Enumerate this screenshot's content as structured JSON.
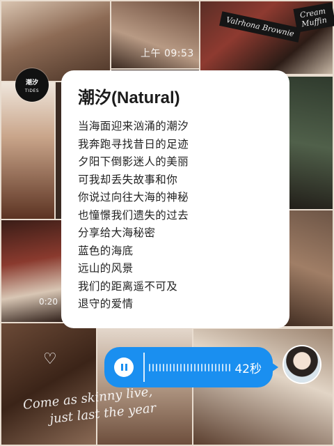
{
  "status": {
    "time": "上午 09:53"
  },
  "background": {
    "signs": [
      "Valrhona Brownie",
      "Cream Muffin"
    ],
    "handwriting": [
      "Come as skinny live,",
      "just last the year"
    ],
    "timestamp": "0:20"
  },
  "sender": {
    "avatar_text": "潮汐",
    "avatar_sub": "TIDES"
  },
  "card": {
    "title": "潮汐(Natural)",
    "lyrics": [
      "当海面迎来汹涌的潮汐",
      "我奔跑寻找昔日的足迹",
      "夕阳下倒影迷人的美丽",
      "可我却丢失故事和你",
      "你说过向往大海的神秘",
      "也憧憬我们遗失的过去",
      "分享给大海秘密",
      "蓝色的海底",
      "远山的风景",
      "我们的距离遥不可及",
      "退守的爱情"
    ]
  },
  "voice_message": {
    "duration": "42秒",
    "state": "playing",
    "accent_color": "#1a8ff0"
  },
  "icons": [
    "pause-icon",
    "heart-icon"
  ]
}
